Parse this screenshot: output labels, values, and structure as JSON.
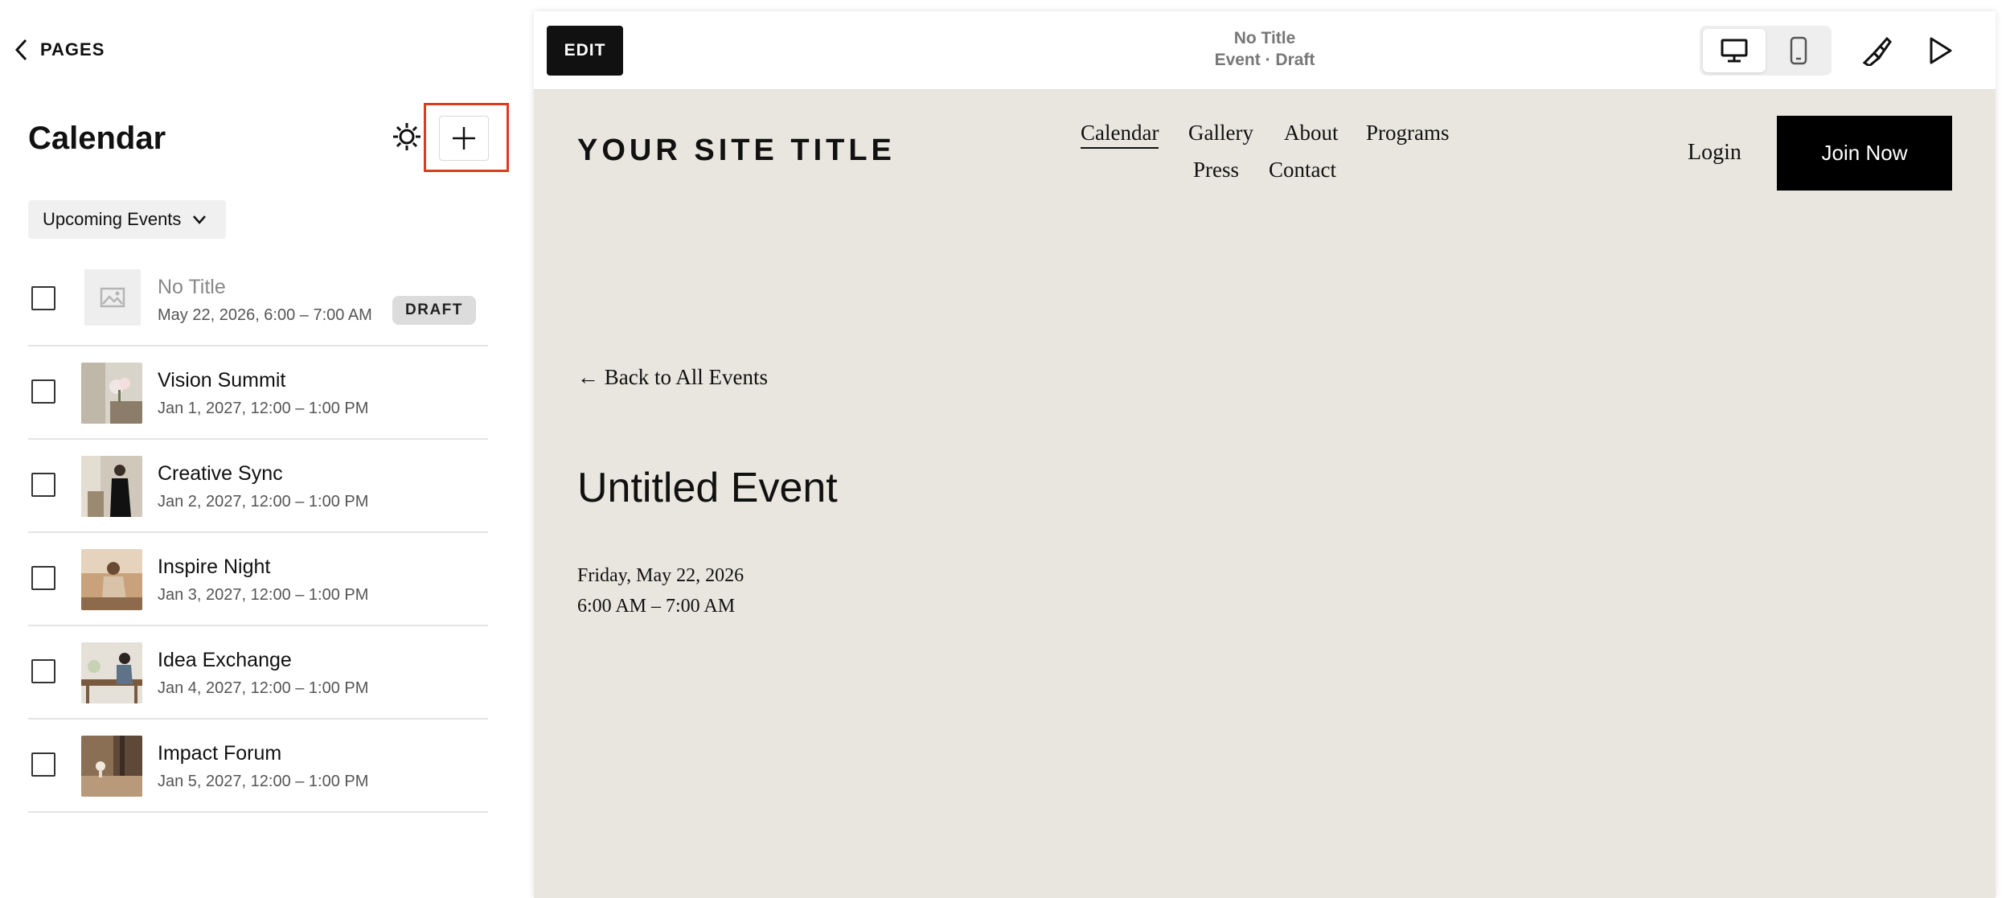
{
  "sidebar": {
    "back_label": "PAGES",
    "title": "Calendar",
    "filter_label": "Upcoming Events",
    "events": [
      {
        "name": "No Title",
        "date": "May 22, 2026, 6:00 – 7:00 AM",
        "badge": "DRAFT",
        "image": "placeholder"
      },
      {
        "name": "Vision Summit",
        "date": "Jan 1, 2027, 12:00 – 1:00 PM",
        "image": "flowers-interior"
      },
      {
        "name": "Creative Sync",
        "date": "Jan 2, 2027, 12:00 – 1:00 PM",
        "image": "woman-standing"
      },
      {
        "name": "Inspire Night",
        "date": "Jan 3, 2027, 12:00 – 1:00 PM",
        "image": "woman-seated"
      },
      {
        "name": "Idea Exchange",
        "date": "Jan 4, 2027, 12:00 – 1:00 PM",
        "image": "person-at-desk"
      },
      {
        "name": "Impact Forum",
        "date": "Jan 5, 2027, 12:00 – 1:00 PM",
        "image": "table-lamp"
      }
    ]
  },
  "preview": {
    "edit_label": "EDIT",
    "page_name": "No Title",
    "page_status": "Event · Draft",
    "icons": [
      "desktop-icon",
      "mobile-icon",
      "paintbrush-icon",
      "play-icon"
    ]
  },
  "site": {
    "title": "YOUR SITE TITLE",
    "nav": [
      "Calendar",
      "Gallery",
      "About",
      "Programs",
      "Press",
      "Contact"
    ],
    "active_nav": "Calendar",
    "login": "Login",
    "cta": "Join Now",
    "back_link": "← Back to All Events",
    "event_title": "Untitled Event",
    "event_date": "Friday, May 22, 2026",
    "event_time": "6:00 AM – 7:00 AM"
  },
  "colors": {
    "highlight": "#e03a1e",
    "preview_bg": "#e8e6de",
    "button_dark": "#000000"
  }
}
